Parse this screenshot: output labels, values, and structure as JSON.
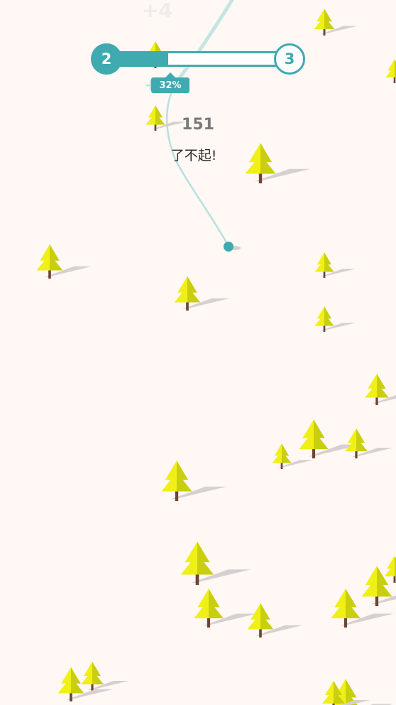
{
  "game": {
    "ghost_score_text": "+4",
    "ghost_plus_text": "+",
    "progress": {
      "current_level": "2",
      "next_level": "3",
      "percent_label": "32%",
      "fraction": 0.32
    },
    "score": "151",
    "praise": "了不起!"
  },
  "colors": {
    "background": "#fff8f5",
    "accent": "#3faaaf",
    "trail": "#bfe3e1",
    "tree_light": "#f0f016",
    "tree_dark": "#c9cf0e",
    "trunk": "#6b4536",
    "shadow": "#d6d1d0"
  }
}
